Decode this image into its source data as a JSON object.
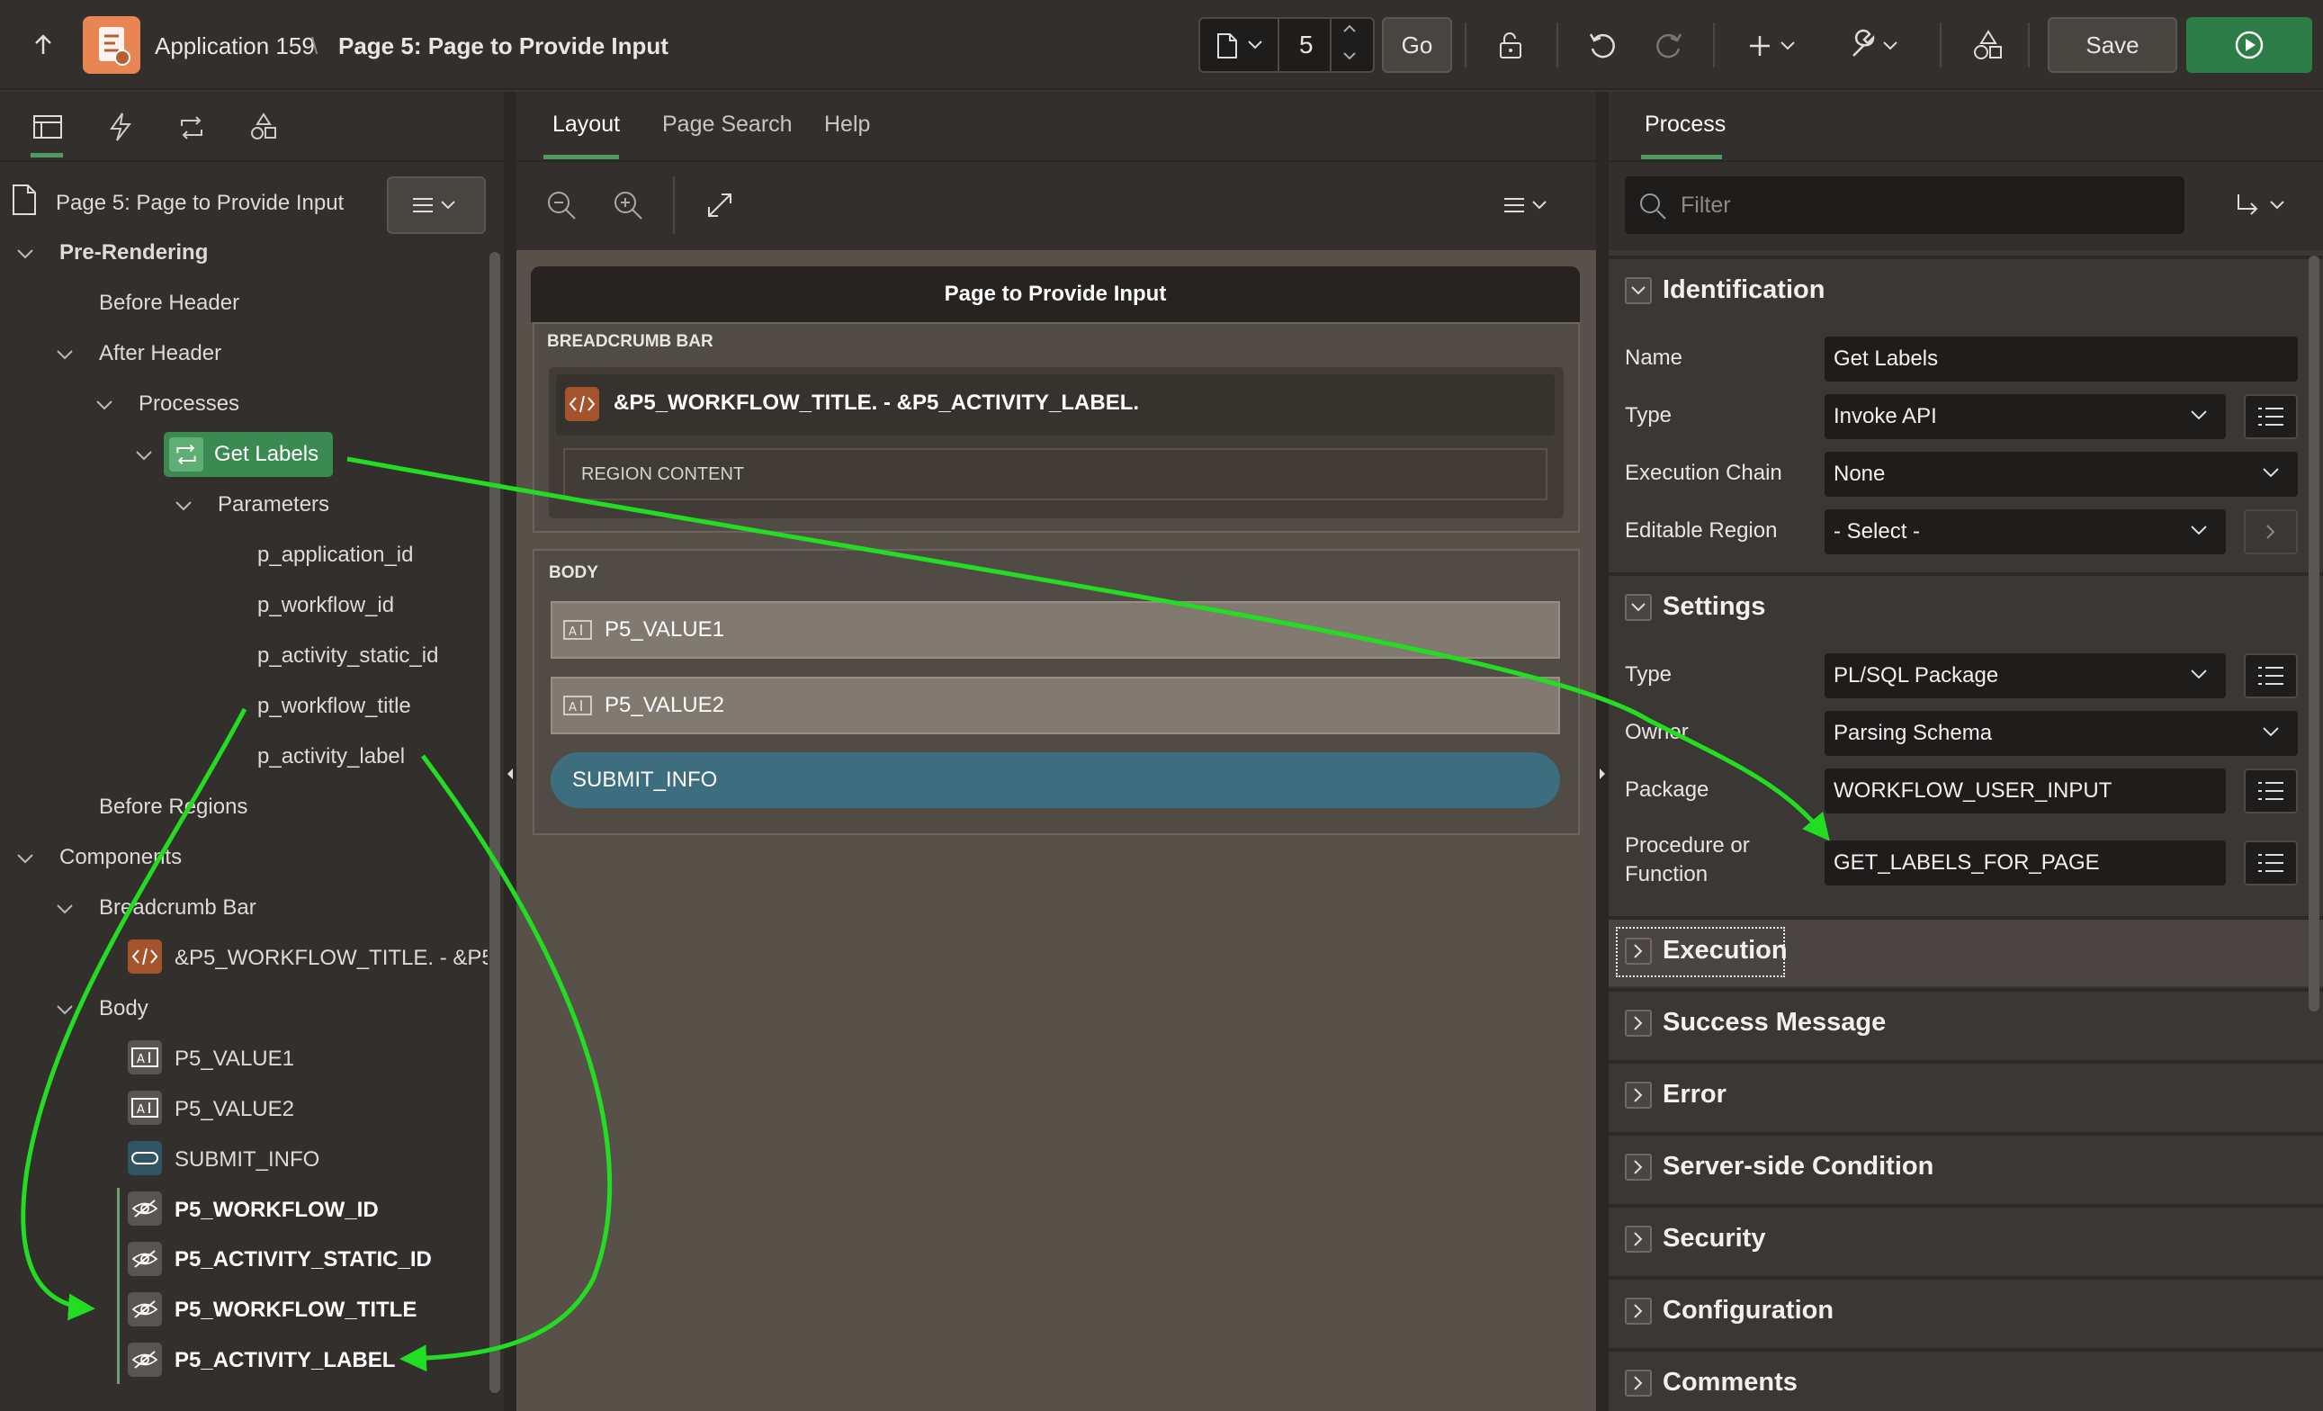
{
  "header": {
    "app_label": "Application 159",
    "separator": "\\",
    "page_label": "Page 5: Page to Provide Input",
    "page_number": "5",
    "go_label": "Go",
    "save_label": "Save"
  },
  "left": {
    "page_node": "Page 5: Page to Provide Input",
    "tree": {
      "pre_rendering": "Pre-Rendering",
      "before_header": "Before Header",
      "after_header": "After Header",
      "processes": "Processes",
      "get_labels": "Get Labels",
      "parameters": "Parameters",
      "p1": "p_application_id",
      "p2": "p_workflow_id",
      "p3": "p_activity_static_id",
      "p4": "p_workflow_title",
      "p5": "p_activity_label",
      "before_regions": "Before Regions",
      "components": "Components",
      "breadcrumb_bar": "Breadcrumb Bar",
      "breadcrumb_region": "&P5_WORKFLOW_TITLE. - &P5_",
      "body": "Body",
      "i1": "P5_VALUE1",
      "i2": "P5_VALUE2",
      "i3": "SUBMIT_INFO",
      "h1": "P5_WORKFLOW_ID",
      "h2": "P5_ACTIVITY_STATIC_ID",
      "h3": "P5_WORKFLOW_TITLE",
      "h4": "P5_ACTIVITY_LABEL"
    }
  },
  "center": {
    "tabs": [
      "Layout",
      "Page Search",
      "Help"
    ],
    "page_title": "Page to Provide Input",
    "breadcrumb_bar_label": "BREADCRUMB BAR",
    "breadcrumb_region": "&P5_WORKFLOW_TITLE. - &P5_ACTIVITY_LABEL.",
    "region_content": "REGION CONTENT",
    "body_label": "BODY",
    "item1": "P5_VALUE1",
    "item2": "P5_VALUE2",
    "button": "SUBMIT_INFO"
  },
  "right": {
    "tab": "Process",
    "filter_placeholder": "Filter",
    "identification": {
      "title": "Identification",
      "name_label": "Name",
      "name_value": "Get Labels",
      "type_label": "Type",
      "type_value": "Invoke API",
      "chain_label": "Execution Chain",
      "chain_value": "None",
      "editable_label": "Editable Region",
      "editable_value": "- Select -"
    },
    "settings": {
      "title": "Settings",
      "type_label": "Type",
      "type_value": "PL/SQL Package",
      "owner_label": "Owner",
      "owner_value": "Parsing Schema",
      "package_label": "Package",
      "package_value": "WORKFLOW_USER_INPUT",
      "proc_label_1": "Procedure or",
      "proc_label_2": "Function",
      "proc_value": "GET_LABELS_FOR_PAGE"
    },
    "sections": [
      "Execution",
      "Success Message",
      "Error",
      "Server-side Condition",
      "Security",
      "Configuration",
      "Comments"
    ]
  },
  "colors": {
    "accent_green": "#2d7d46",
    "annotation_green": "#22dd22",
    "button_blue": "#3c6e80",
    "region_orange": "#b75e32"
  }
}
